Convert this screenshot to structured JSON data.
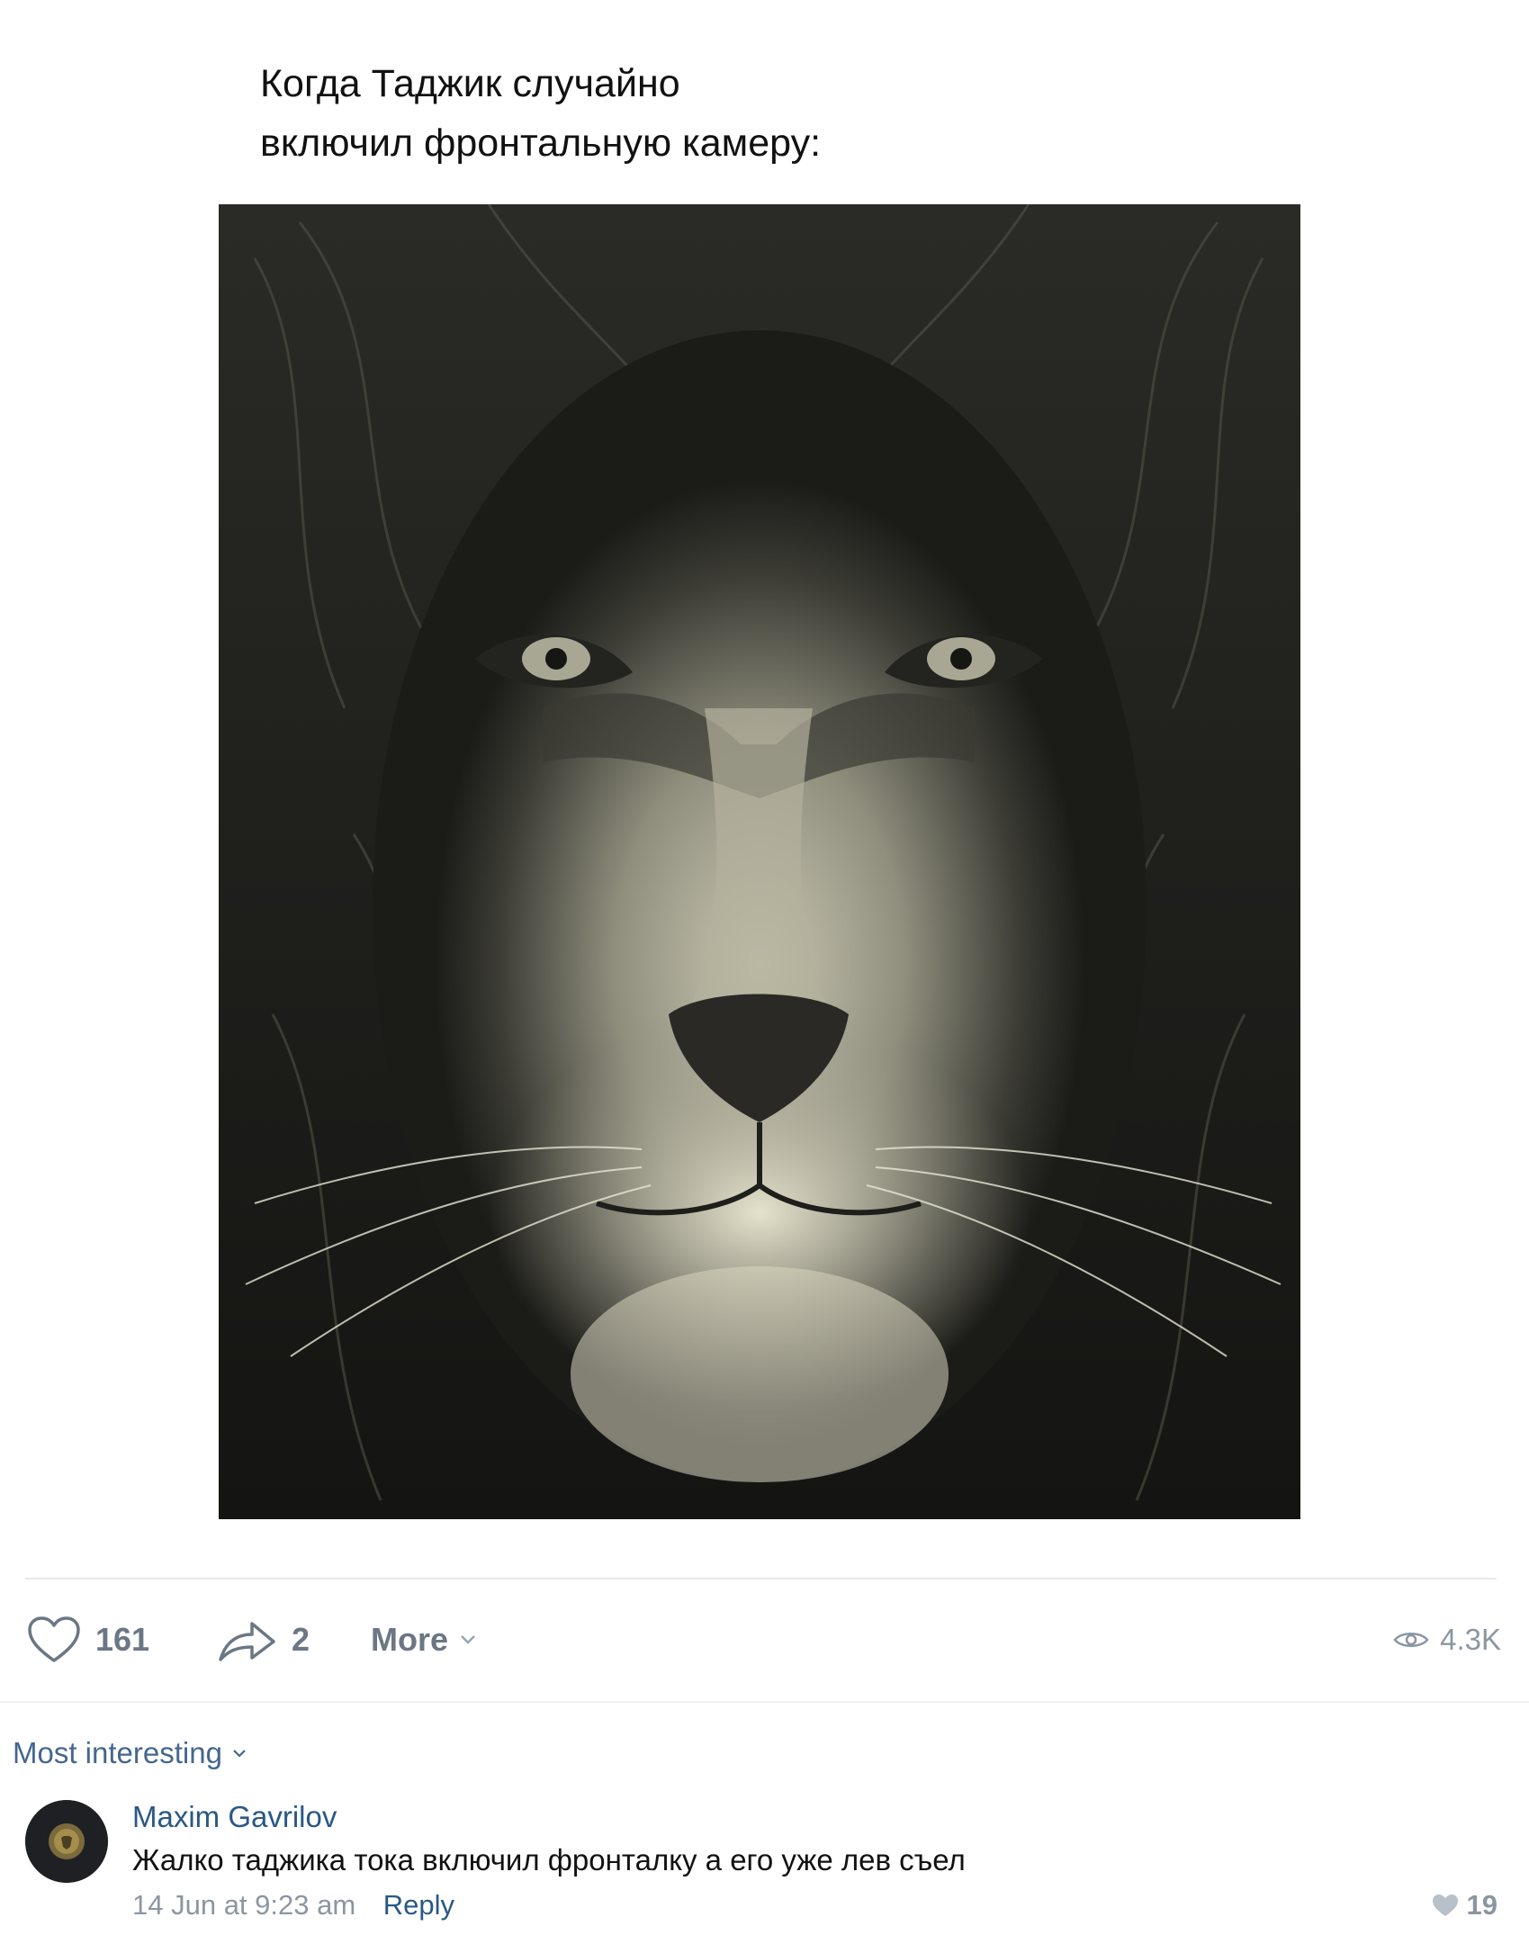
{
  "post": {
    "caption_lines": [
      "Когда Таджик случайно",
      "включил фронтальную камеру:"
    ],
    "photo_icon": "lion-photo"
  },
  "actions": {
    "likes": "161",
    "shares": "2",
    "more_label": "More",
    "views": "4.3K"
  },
  "comments_section": {
    "sort_label": "Most interesting"
  },
  "comment": {
    "author": "Maxim Gavrilov",
    "text": "Жалко таджика тока включил фронталку а его уже лев съел",
    "timestamp": "14 Jun at 9:23 am",
    "reply_label": "Reply",
    "likes": "19"
  },
  "colors": {
    "link": "#2a5885",
    "muted": "#8c96a2",
    "action": "#6b7785"
  }
}
